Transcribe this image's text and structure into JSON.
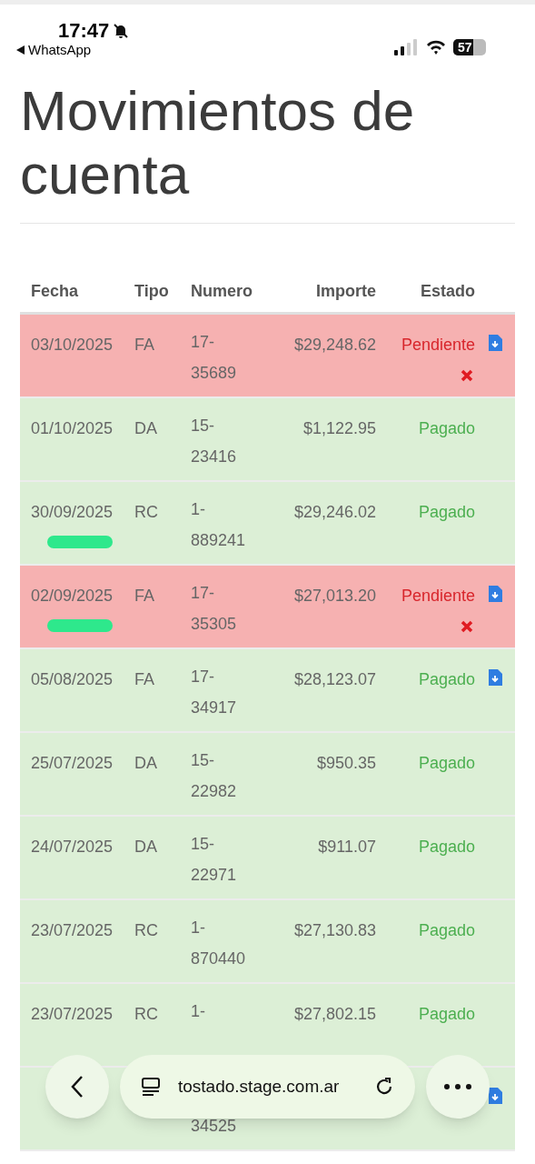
{
  "status_bar": {
    "time": "17:47",
    "back_app": "WhatsApp",
    "battery": "57"
  },
  "title": "Movimientos de cuenta",
  "table": {
    "columns": [
      "Fecha",
      "Tipo",
      "Numero",
      "Importe",
      "Estado"
    ],
    "rows": [
      {
        "fecha": "03/10/2025",
        "tipo": "FA",
        "numero": [
          "17-",
          "35689"
        ],
        "importe": "$29,248.62",
        "estado": "Pendiente",
        "kind": "pending",
        "download": true,
        "marked": false
      },
      {
        "fecha": "01/10/2025",
        "tipo": "DA",
        "numero": [
          "15-",
          "23416"
        ],
        "importe": "$1,122.95",
        "estado": "Pagado",
        "kind": "paid",
        "download": false,
        "marked": false
      },
      {
        "fecha": "30/09/2025",
        "tipo": "RC",
        "numero": [
          "1-",
          "889241"
        ],
        "importe": "$29,246.02",
        "estado": "Pagado",
        "kind": "paid",
        "download": false,
        "marked": true
      },
      {
        "fecha": "02/09/2025",
        "tipo": "FA",
        "numero": [
          "17-",
          "35305"
        ],
        "importe": "$27,013.20",
        "estado": "Pendiente",
        "kind": "pending",
        "download": true,
        "marked": true
      },
      {
        "fecha": "05/08/2025",
        "tipo": "FA",
        "numero": [
          "17-",
          "34917"
        ],
        "importe": "$28,123.07",
        "estado": "Pagado",
        "kind": "paid",
        "download": true,
        "marked": false
      },
      {
        "fecha": "25/07/2025",
        "tipo": "DA",
        "numero": [
          "15-",
          "22982"
        ],
        "importe": "$950.35",
        "estado": "Pagado",
        "kind": "paid",
        "download": false,
        "marked": false
      },
      {
        "fecha": "24/07/2025",
        "tipo": "DA",
        "numero": [
          "15-",
          "22971"
        ],
        "importe": "$911.07",
        "estado": "Pagado",
        "kind": "paid",
        "download": false,
        "marked": false
      },
      {
        "fecha": "23/07/2025",
        "tipo": "RC",
        "numero": [
          "1-",
          "870440"
        ],
        "importe": "$27,130.83",
        "estado": "Pagado",
        "kind": "paid",
        "download": false,
        "marked": false
      },
      {
        "fecha": "23/07/2025",
        "tipo": "RC",
        "numero": [
          "1-"
        ],
        "importe": "$27,802.15",
        "estado": "Pagado",
        "kind": "paid",
        "download": false,
        "marked": false
      },
      {
        "numero": [
          "34525"
        ],
        "kind": "paid",
        "download": true,
        "marked": false,
        "covered": true
      }
    ]
  },
  "browser_bar": {
    "url": "tostado.stage.com.ar"
  }
}
